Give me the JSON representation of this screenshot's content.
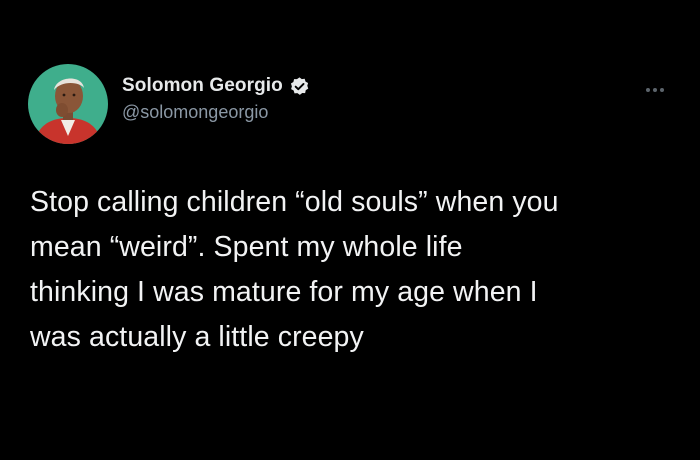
{
  "author": {
    "display_name": "Solomon Georgio",
    "handle": "@solomongeorgio",
    "verified": true
  },
  "tweet": {
    "text": "Stop calling children “old souls” when you\nmean “weird”. Spent my whole life\nthinking I was mature for my age when I\nwas actually a little creepy"
  },
  "icons": {
    "verified": "verified-badge-icon",
    "more": "more-options-icon"
  },
  "colors": {
    "background": "#000000",
    "text": "#e7e9ea",
    "secondary_text": "#8b98a5",
    "avatar_bg": "#3fae8c"
  }
}
